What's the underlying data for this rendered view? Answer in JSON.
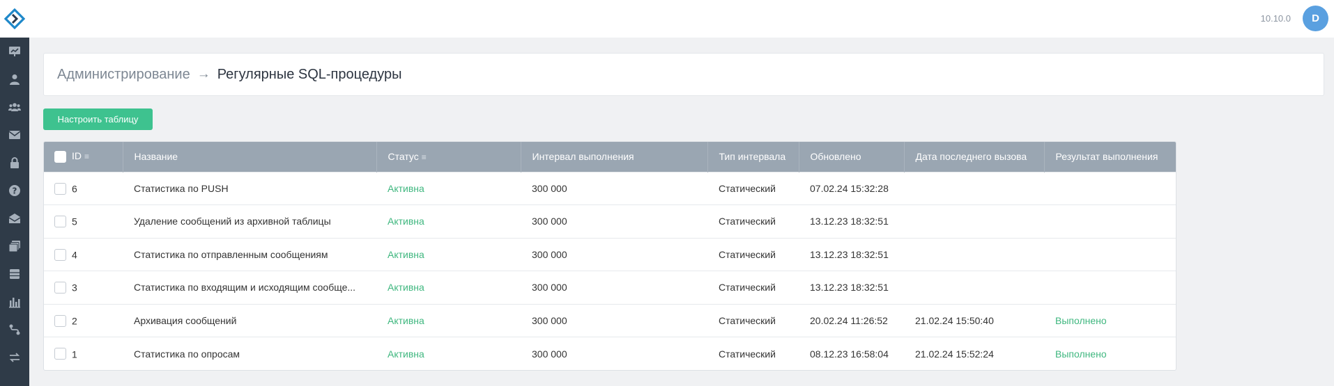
{
  "topbar": {
    "version": "10.10.0",
    "avatar_letter": "D"
  },
  "sidebar": {
    "items": [
      {
        "icon": "chart-board-icon"
      },
      {
        "icon": "user-icon"
      },
      {
        "icon": "users-group-icon"
      },
      {
        "icon": "mail-icon"
      },
      {
        "icon": "lock-icon"
      },
      {
        "icon": "help-icon"
      },
      {
        "icon": "mail-open-icon"
      },
      {
        "icon": "layers-icon"
      },
      {
        "icon": "database-icon"
      },
      {
        "icon": "bar-chart-icon"
      },
      {
        "icon": "route-icon"
      },
      {
        "icon": "transfer-icon"
      }
    ]
  },
  "breadcrumb": {
    "root": "Администрирование",
    "arrow": "→",
    "current": "Регулярные SQL-процедуры"
  },
  "toolbar": {
    "configure_label": "Настроить таблицу"
  },
  "table": {
    "columns": {
      "id": "ID",
      "name": "Название",
      "status": "Статус",
      "interval": "Интервал выполнения",
      "interval_type": "Тип интервала",
      "updated": "Обновлено",
      "last_call": "Дата последнего вызова",
      "result": "Результат выполнения"
    },
    "sort_icon": "≡",
    "rows": [
      {
        "id": "6",
        "name": "Статистика по PUSH",
        "status": "Активна",
        "interval": "300 000",
        "interval_type": "Статический",
        "updated": "07.02.24 15:32:28",
        "last_call": "",
        "result": ""
      },
      {
        "id": "5",
        "name": "Удаление сообщений из архивной таблицы",
        "status": "Активна",
        "interval": "300 000",
        "interval_type": "Статический",
        "updated": "13.12.23 18:32:51",
        "last_call": "",
        "result": ""
      },
      {
        "id": "4",
        "name": "Статистика по отправленным сообщениям",
        "status": "Активна",
        "interval": "300 000",
        "interval_type": "Статический",
        "updated": "13.12.23 18:32:51",
        "last_call": "",
        "result": ""
      },
      {
        "id": "3",
        "name": "Статистика по входящим и исходящим сообще...",
        "status": "Активна",
        "interval": "300 000",
        "interval_type": "Статический",
        "updated": "13.12.23 18:32:51",
        "last_call": "",
        "result": ""
      },
      {
        "id": "2",
        "name": "Архивация сообщений",
        "status": "Активна",
        "interval": "300 000",
        "interval_type": "Статический",
        "updated": "20.02.24 11:26:52",
        "last_call": "21.02.24 15:50:40",
        "result": "Выполнено"
      },
      {
        "id": "1",
        "name": "Статистика по опросам",
        "status": "Активна",
        "interval": "300 000",
        "interval_type": "Статический",
        "updated": "08.12.23 16:58:04",
        "last_call": "21.02.24 15:52:24",
        "result": "Выполнено"
      }
    ]
  },
  "colors": {
    "accent_green": "#3ec28f",
    "status_green": "#3fb77f",
    "sidebar_bg": "#2f3b48",
    "header_row_bg": "#9aa6b2",
    "avatar_bg": "#5aa0e0"
  }
}
